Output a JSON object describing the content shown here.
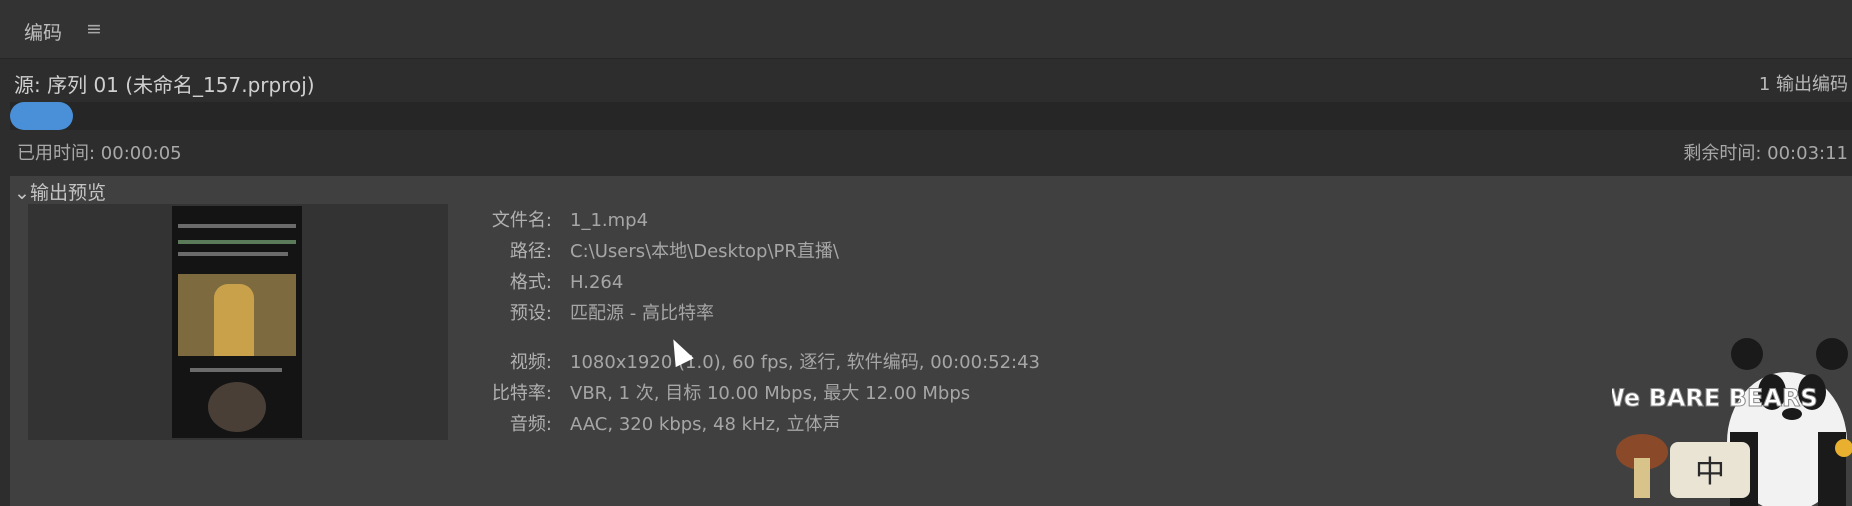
{
  "panel": {
    "title": "编码",
    "menu_icon": "hamburger-menu-icon"
  },
  "source": {
    "label": "源: 序列 01 (未命名_157.prproj)",
    "output_count": "1 输出编码"
  },
  "progress": {
    "fraction": 0.034,
    "color": "#4a90d9"
  },
  "timing": {
    "elapsed": "已用时间: 00:00:05",
    "remaining": "剩余时间: 00:03:11"
  },
  "preview": {
    "section_label": "输出预览",
    "toggle_icon": "chevron-down-icon",
    "details": [
      {
        "label": "文件名:",
        "value": "1_1.mp4"
      },
      {
        "label": "路径:",
        "value": "C:\\Users\\本地\\Desktop\\PR直播\\"
      },
      {
        "label": "格式:",
        "value": "H.264"
      },
      {
        "label": "预设:",
        "value": "匹配源 - 高比特率"
      },
      {
        "label": "视频:",
        "value": "1080x1920 (1.0), 60 fps, 逐行, 软件编码, 00:00:52:43"
      },
      {
        "label": "比特率:",
        "value": "VBR, 1 次, 目标 10.00 Mbps, 最大 12.00 Mbps"
      },
      {
        "label": "音频:",
        "value": "AAC, 320 kbps, 48 kHz, 立体声"
      }
    ]
  },
  "overlay": {
    "watermark_text": "We BARE BEARS",
    "watermark_glyph": "中"
  },
  "colors": {
    "accent": "#4a90d9",
    "panel_bg": "#404040",
    "app_bg": "#2d2d2d"
  }
}
